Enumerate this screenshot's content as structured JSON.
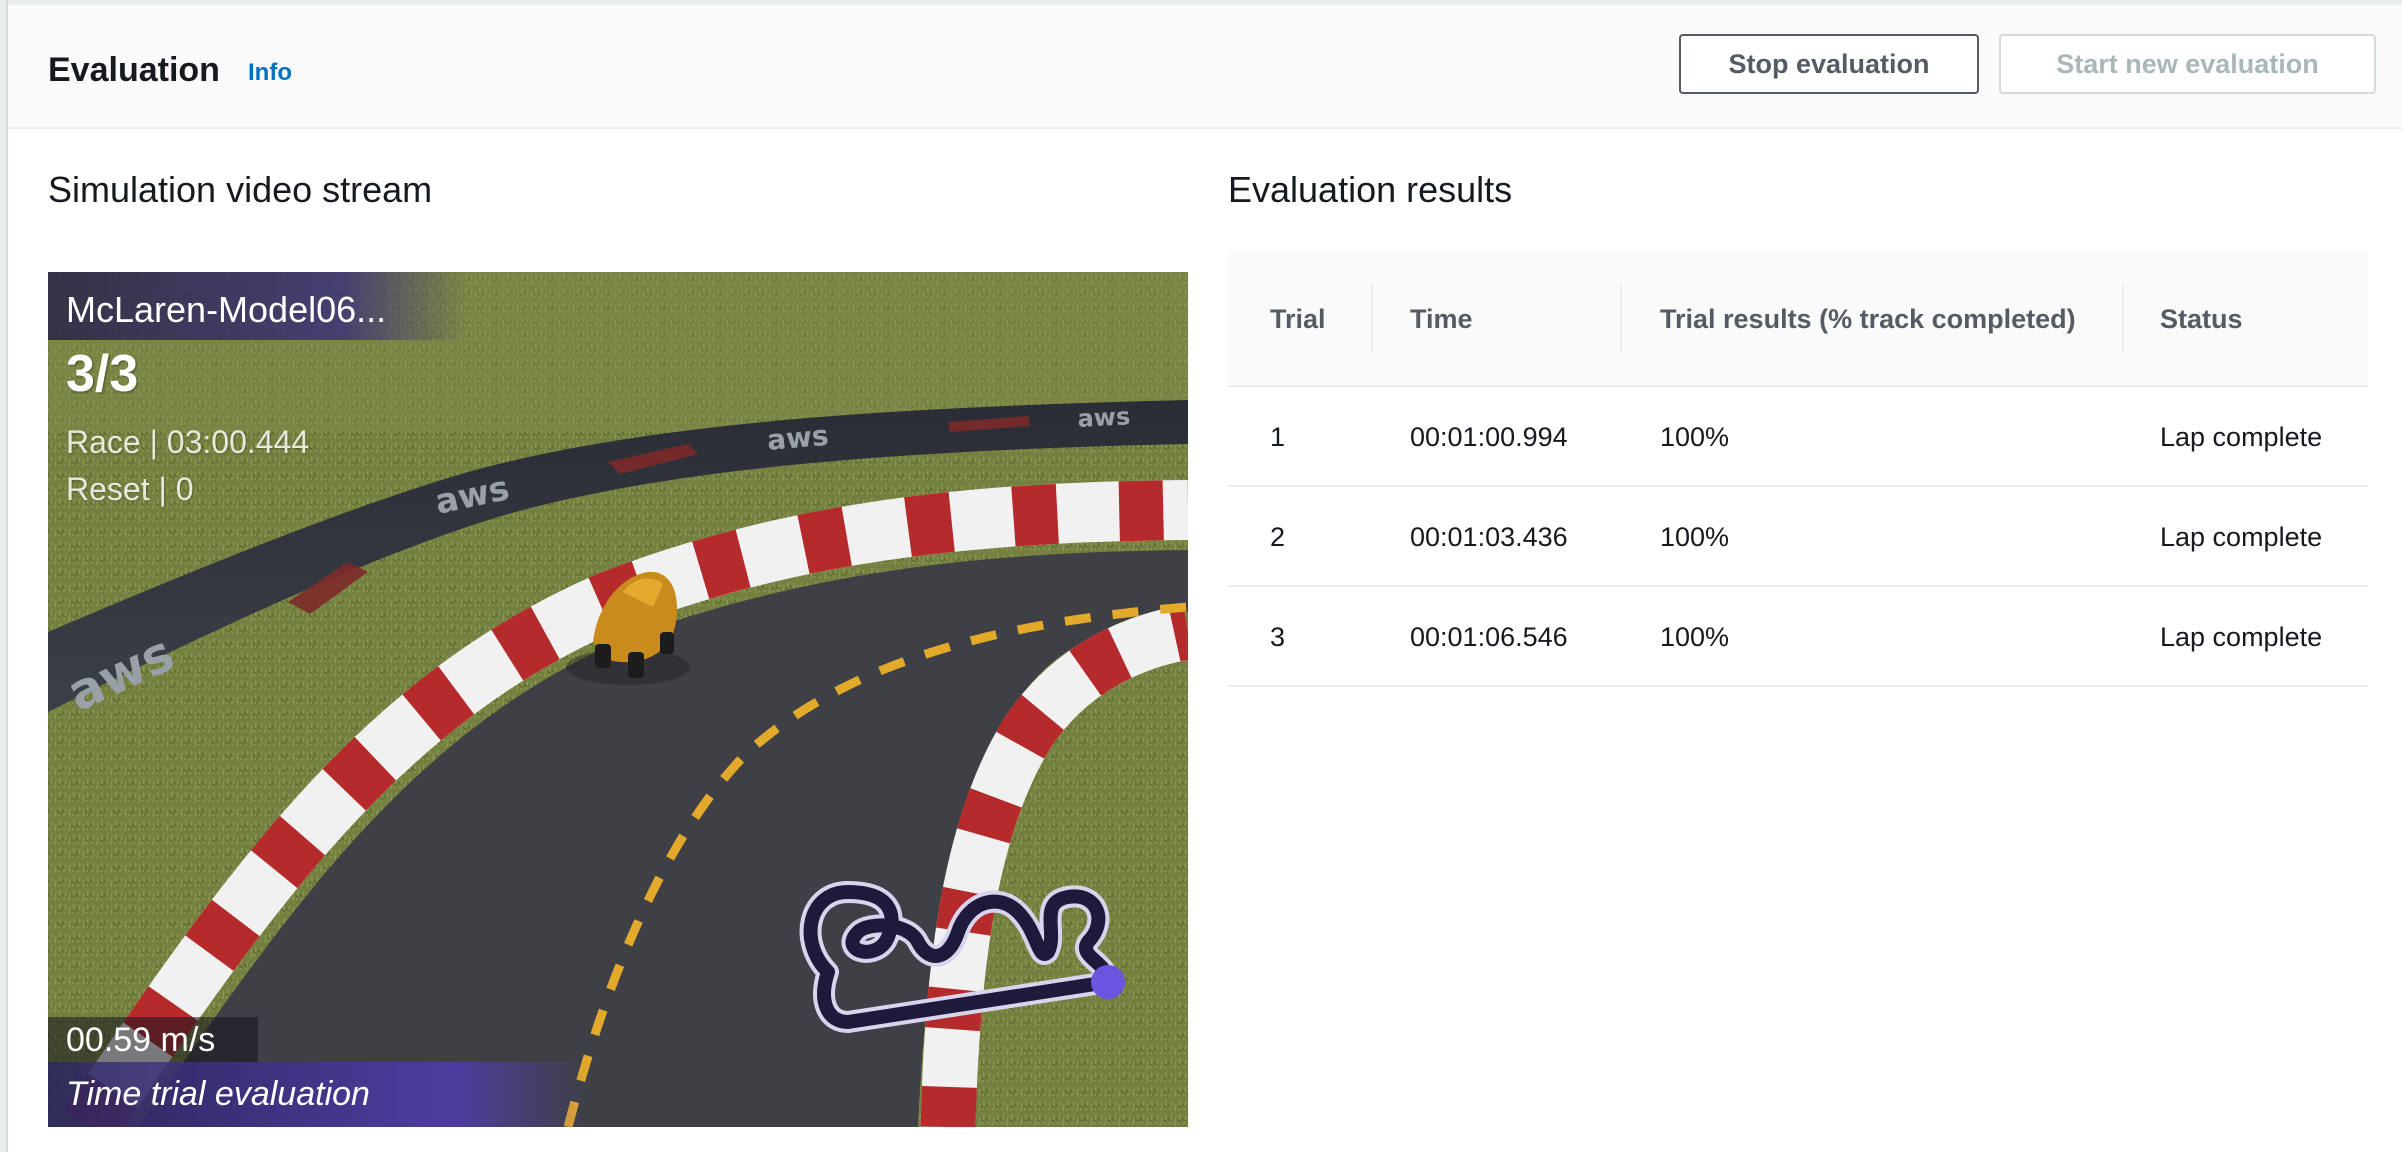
{
  "header": {
    "title": "Evaluation",
    "info_label": "Info",
    "stop_button": "Stop evaluation",
    "start_button": "Start new evaluation"
  },
  "simulation": {
    "section_title": "Simulation video stream",
    "hud": {
      "model_name": "McLaren-Model06...",
      "lap": "3/3",
      "race_time": "Race | 03:00.444",
      "resets": "Reset | 0",
      "speed": "00.59 m/s",
      "mode": "Time trial evaluation"
    },
    "banner_text": "aws"
  },
  "results": {
    "section_title": "Evaluation results",
    "columns": [
      "Trial",
      "Time",
      "Trial results (% track completed)",
      "Status"
    ],
    "rows": [
      {
        "trial": "1",
        "time": "00:01:00.994",
        "result": "100%",
        "status": "Lap complete"
      },
      {
        "trial": "2",
        "time": "00:01:03.436",
        "result": "100%",
        "status": "Lap complete"
      },
      {
        "trial": "3",
        "time": "00:01:06.546",
        "result": "100%",
        "status": "Lap complete"
      }
    ]
  },
  "colors": {
    "link": "#0073bb",
    "text": "#16191f",
    "muted": "#545b64",
    "disabled": "#aab7b8",
    "border": "#eaeded",
    "hud_purple": "#5a46b4"
  }
}
